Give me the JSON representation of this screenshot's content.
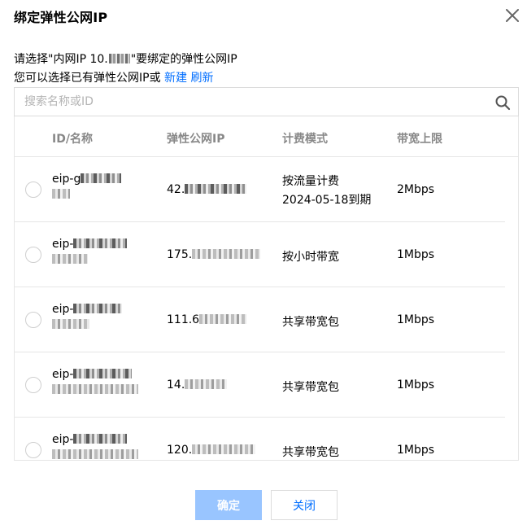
{
  "dialog": {
    "title": "绑定弹性公网IP"
  },
  "description": {
    "line1_prefix": "请选择\"内网IP 10.",
    "line1_suffix": "\"要绑定的弹性公网IP",
    "line2_text": "您可以选择已有弹性公网IP或",
    "new_link": "新建",
    "refresh_link": "刷新"
  },
  "search": {
    "placeholder": "搜索名称或ID"
  },
  "table": {
    "headers": {
      "id_name": "ID/名称",
      "eip": "弹性公网IP",
      "billing": "计费模式",
      "bandwidth": "带宽上限"
    },
    "rows": [
      {
        "id_prefix": "eip-g",
        "ip_prefix": "42.",
        "billing": "按流量计费",
        "billing_note": "2024-05-18到期",
        "bandwidth": "2Mbps"
      },
      {
        "id_prefix": "eip-",
        "ip_prefix": "175.",
        "billing": "按小时带宽",
        "billing_note": "",
        "bandwidth": "1Mbps"
      },
      {
        "id_prefix": "eip-",
        "ip_prefix": "111.6",
        "billing": "共享带宽包",
        "billing_note": "",
        "bandwidth": "1Mbps"
      },
      {
        "id_prefix": "eip-",
        "ip_prefix": "14.",
        "billing": "共享带宽包",
        "billing_note": "",
        "bandwidth": "1Mbps"
      },
      {
        "id_prefix": "eip-",
        "ip_prefix": "120.",
        "billing": "共享带宽包",
        "billing_note": "",
        "bandwidth": "1Mbps"
      }
    ]
  },
  "footer": {
    "confirm_label": "确定",
    "close_label": "关闭"
  },
  "colors": {
    "link": "#006eff",
    "confirm_disabled_bg": "#99c5ff"
  },
  "icons": {
    "close": "close-icon",
    "search": "search-icon"
  }
}
